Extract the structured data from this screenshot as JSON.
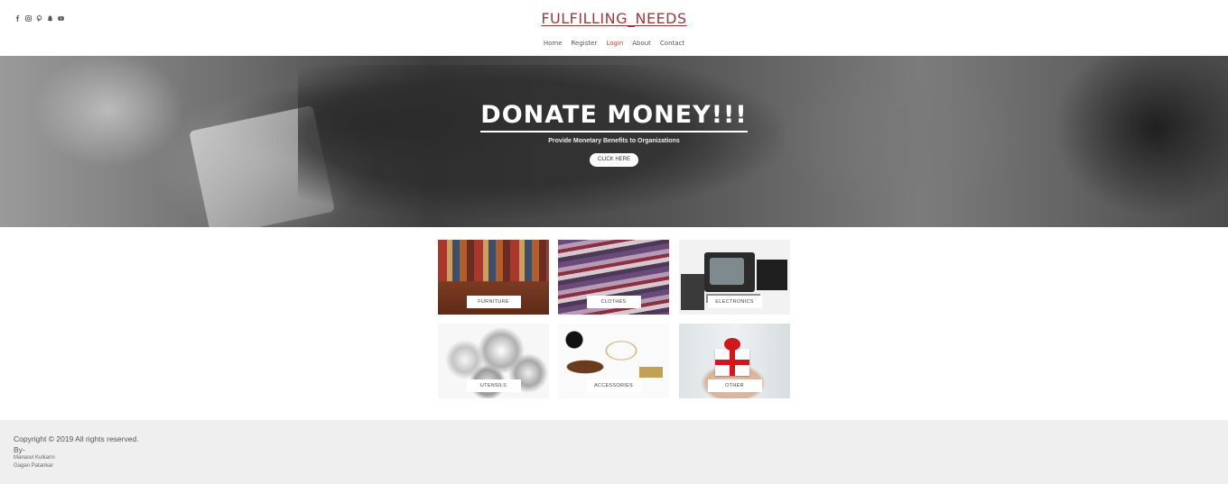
{
  "header": {
    "brand": "FULFILLING_NEEDS",
    "social": [
      "facebook-icon",
      "instagram-icon",
      "pinterest-icon",
      "snapchat-icon",
      "youtube-icon"
    ],
    "nav": [
      {
        "label": "Home",
        "active": false
      },
      {
        "label": "Register",
        "active": false
      },
      {
        "label": "Login",
        "active": true
      },
      {
        "label": "About",
        "active": false
      },
      {
        "label": "Contact",
        "active": false
      }
    ]
  },
  "hero": {
    "title": "DONATE MONEY!!!",
    "subtitle": "Provide Monetary Benefits to Organizations",
    "button": "CLICK HERE"
  },
  "categories": [
    {
      "label": "FURNITURE"
    },
    {
      "label": "CLOTHES"
    },
    {
      "label": "ELECTRONICS"
    },
    {
      "label": "UTENSILS"
    },
    {
      "label": "ACCESSORIES"
    },
    {
      "label": "OTHER"
    }
  ],
  "footer": {
    "copyright": "Copyright © 2019 All rights reserved.",
    "by": "By-",
    "authors": [
      "Manasvi Kulkarni",
      "Gagan Patankar"
    ]
  },
  "colors": {
    "brand": "#a8343a",
    "active_nav": "#c9503f",
    "footer_bg": "#efefef"
  }
}
